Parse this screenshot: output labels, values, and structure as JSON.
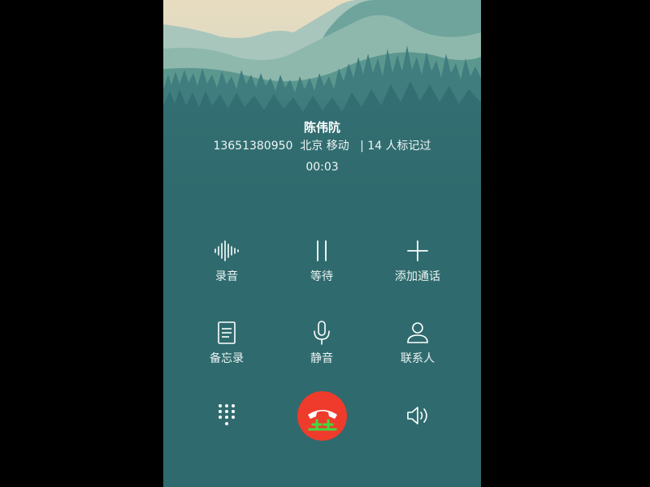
{
  "caller": {
    "name": "陈伟阬",
    "info": "13651380950  北京 移动   | 14 人标记过",
    "duration": "00:03"
  },
  "actions_row1": [
    {
      "label": "录音",
      "icon": "waveform-icon"
    },
    {
      "label": "等待",
      "icon": "pause-icon"
    },
    {
      "label": "添加通话",
      "icon": "plus-icon"
    }
  ],
  "actions_row2": [
    {
      "label": "备忘录",
      "icon": "note-icon"
    },
    {
      "label": "静音",
      "icon": "microphone-icon"
    },
    {
      "label": "联系人",
      "icon": "person-icon"
    }
  ],
  "bottom": {
    "dialpad_icon": "dialpad-icon",
    "hangup_icon": "hangup-phone-icon",
    "speaker_icon": "speaker-icon"
  },
  "colors": {
    "background": "#2f6b6e",
    "hangup": "#ef3b2c",
    "overlay_mark": "#3ddc3d"
  }
}
